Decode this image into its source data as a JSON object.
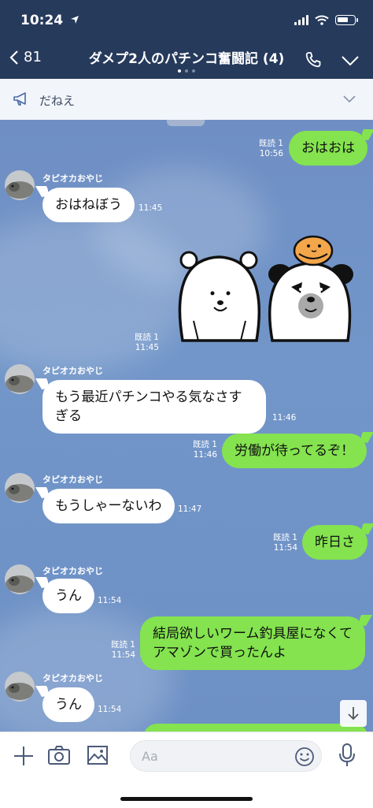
{
  "status": {
    "time": "10:24"
  },
  "header": {
    "back_count": "81",
    "title": "ダメプ2人のパチンコ奮闘記 (4)"
  },
  "announcement": {
    "text": "だねえ"
  },
  "contact": {
    "name": "タピオカおやじ"
  },
  "messages": [
    {
      "side": "right",
      "text": "おはおは",
      "read": "既読 1",
      "time": "10:56"
    },
    {
      "side": "left",
      "name": "タピオカおやじ",
      "text": "おはねぼう",
      "time": "11:45"
    },
    {
      "side": "right",
      "type": "sticker",
      "read": "既読 1",
      "time": "11:45"
    },
    {
      "side": "left",
      "name": "タピオカおやじ",
      "text": "もう最近パチンコやる気なさすぎる",
      "time": "11:46"
    },
    {
      "side": "right",
      "text": "労働が待ってるぞ！",
      "read": "既読 1",
      "time": "11:46"
    },
    {
      "side": "left",
      "name": "タピオカおやじ",
      "text": "もうしゃーないわ",
      "time": "11:47"
    },
    {
      "side": "right",
      "text": "昨日さ",
      "read": "既読 1",
      "time": "11:54"
    },
    {
      "side": "left",
      "name": "タピオカおやじ",
      "text": "うん",
      "time": "11:54"
    },
    {
      "side": "right",
      "text": "結局欲しいワーム釣具屋になくてアマゾンで買ったんよ",
      "read": "既読 1",
      "time": "11:54"
    },
    {
      "side": "left",
      "name": "タピオカおやじ",
      "text": "うん",
      "time": "11:54"
    }
  ],
  "input": {
    "placeholder": "Aa"
  },
  "colors": {
    "header": "#263a5c",
    "chat_bg": "#6f8fc4",
    "own_bubble": "#84e34f"
  },
  "icons": [
    "back-chevron-icon",
    "phone-icon",
    "chevron-down-icon",
    "megaphone-icon",
    "plus-icon",
    "camera-icon",
    "image-icon",
    "emoji-icon",
    "mic-icon",
    "arrow-down-icon"
  ]
}
